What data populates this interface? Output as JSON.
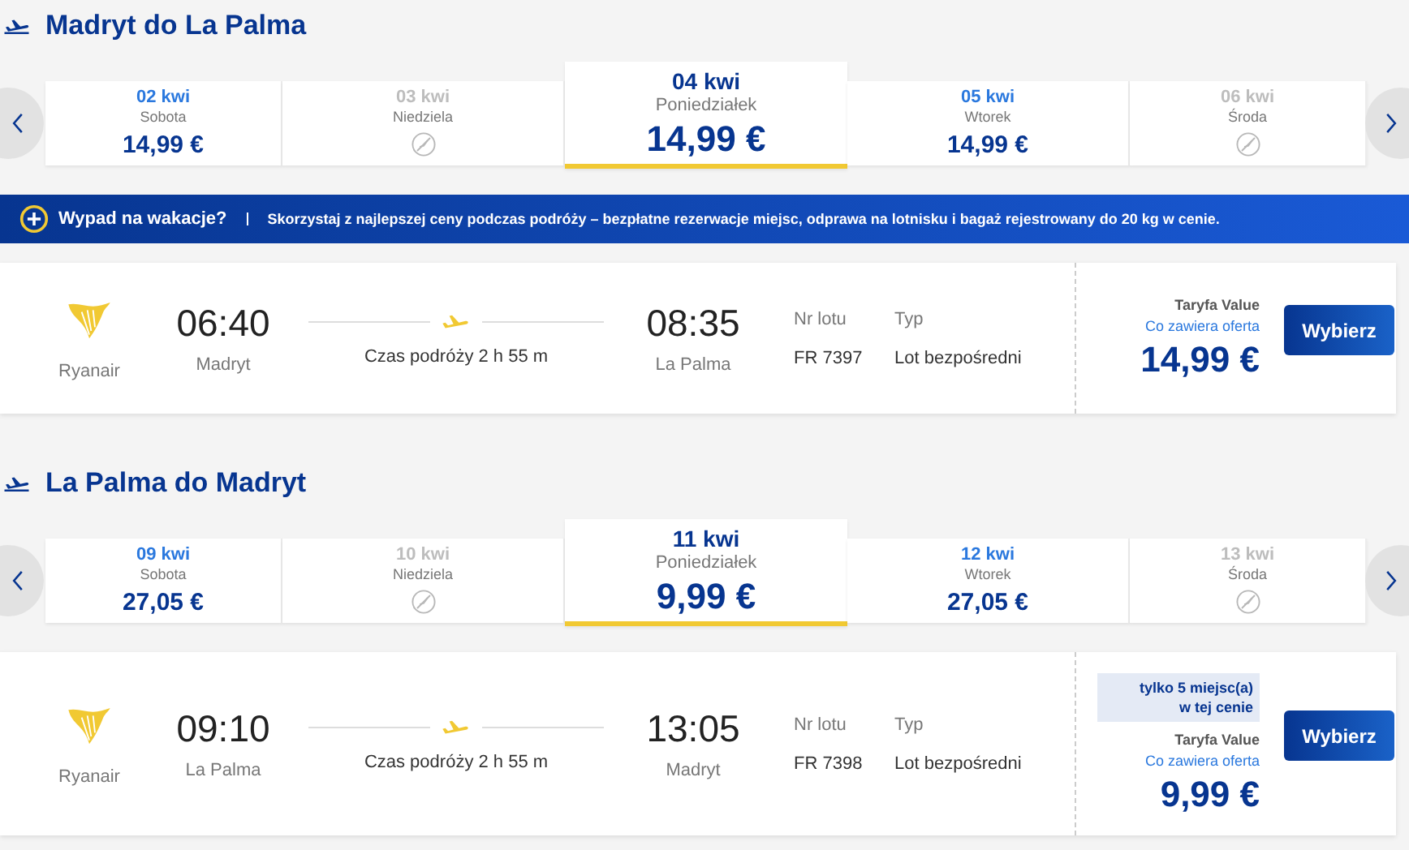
{
  "sections": [
    {
      "title": "Madryt do La Palma",
      "dates": [
        {
          "date": "02 kwi",
          "day": "Sobota",
          "price": "14,99 €",
          "available": true,
          "selected": false
        },
        {
          "date": "03 kwi",
          "day": "Niedziela",
          "available": false,
          "selected": false
        },
        {
          "date": "04 kwi",
          "day": "Poniedziałek",
          "price": "14,99 €",
          "available": true,
          "selected": true
        },
        {
          "date": "05 kwi",
          "day": "Wtorek",
          "price": "14,99 €",
          "available": true,
          "selected": false
        },
        {
          "date": "06 kwi",
          "day": "Środa",
          "available": false,
          "selected": false
        }
      ],
      "banner": {
        "title": "Wypad na wakacje?",
        "text": "Skorzystaj z najlepszej ceny podczas podróży – bezpłatne rezerwacje miejsc, odprawa na lotnisku i bagaż rejestrowany do 20 kg w cenie."
      },
      "flight": {
        "airline": "Ryanair",
        "departure_time": "06:40",
        "departure_city": "Madryt",
        "duration": "Czas podróży 2 h 55 m",
        "arrival_time": "08:35",
        "arrival_city": "La Palma",
        "flight_number_label": "Nr lotu",
        "flight_number": "FR 7397",
        "type_label": "Typ",
        "type": "Lot bezpośredni",
        "fare": "Taryfa Value",
        "offer_link": "Co zawiera oferta",
        "price": "14,99 €",
        "button": "Wybierz"
      }
    },
    {
      "title": "La Palma do Madryt",
      "dates": [
        {
          "date": "09 kwi",
          "day": "Sobota",
          "price": "27,05 €",
          "available": true,
          "selected": false
        },
        {
          "date": "10 kwi",
          "day": "Niedziela",
          "available": false,
          "selected": false
        },
        {
          "date": "11 kwi",
          "day": "Poniedziałek",
          "price": "9,99 €",
          "available": true,
          "selected": true
        },
        {
          "date": "12 kwi",
          "day": "Wtorek",
          "price": "27,05 €",
          "available": true,
          "selected": false
        },
        {
          "date": "13 kwi",
          "day": "Środa",
          "available": false,
          "selected": false
        }
      ],
      "flight": {
        "airline": "Ryanair",
        "departure_time": "09:10",
        "departure_city": "La Palma",
        "duration": "Czas podróży 2 h 55 m",
        "arrival_time": "13:05",
        "arrival_city": "Madryt",
        "flight_number_label": "Nr lotu",
        "flight_number": "FR 7398",
        "type_label": "Typ",
        "type": "Lot bezpośredni",
        "seats_badge": [
          "tylko 5 miejsc(a)",
          "w tej cenie"
        ],
        "fare": "Taryfa Value",
        "offer_link": "Co zawiera oferta",
        "price": "9,99 €",
        "button": "Wybierz"
      }
    }
  ]
}
